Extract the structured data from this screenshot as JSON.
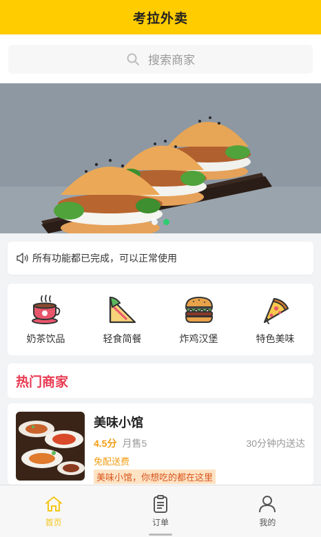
{
  "header": {
    "title": "考拉外卖"
  },
  "search": {
    "placeholder": "搜索商家",
    "icon": "search-icon"
  },
  "banner": {
    "slides": 2,
    "active_slide": 2
  },
  "notice": {
    "icon": "speaker-icon",
    "text": "所有功能都已完成，可以正常使用"
  },
  "categories": [
    {
      "label": "奶茶饮品",
      "icon": "milk-tea-icon"
    },
    {
      "label": "轻食简餐",
      "icon": "sandwich-icon"
    },
    {
      "label": "炸鸡汉堡",
      "icon": "burger-icon"
    },
    {
      "label": "特色美味",
      "icon": "pizza-icon"
    }
  ],
  "hot": {
    "title": "热门商家"
  },
  "shops": [
    {
      "name": "美味小馆",
      "rating": "4.5分",
      "sales": "月售5",
      "eta": "30分钟内送达",
      "free_delivery": "免配送费",
      "slogan": "美味小馆，你想吃的都在这里"
    }
  ],
  "tabbar": {
    "active": "home",
    "items": [
      {
        "key": "home",
        "label": "首页",
        "icon": "home-icon"
      },
      {
        "key": "orders",
        "label": "订单",
        "icon": "orders-icon"
      },
      {
        "key": "mine",
        "label": "我的",
        "icon": "user-icon"
      }
    ]
  },
  "colors": {
    "brand": "#ffcc00",
    "accent": "#e8384f",
    "rating": "#f39c12",
    "active_dot": "#2ecc71"
  }
}
